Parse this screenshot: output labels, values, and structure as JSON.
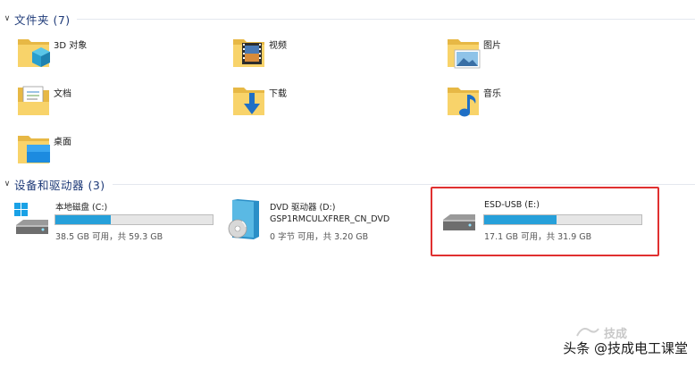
{
  "folders_section": {
    "title": "文件夹 (7)",
    "items": [
      {
        "label": "3D 对象",
        "icon": "3d-objects-folder-icon"
      },
      {
        "label": "视频",
        "icon": "videos-folder-icon"
      },
      {
        "label": "图片",
        "icon": "pictures-folder-icon"
      },
      {
        "label": "文档",
        "icon": "documents-folder-icon"
      },
      {
        "label": "下载",
        "icon": "downloads-folder-icon"
      },
      {
        "label": "音乐",
        "icon": "music-folder-icon"
      },
      {
        "label": "桌面",
        "icon": "desktop-folder-icon"
      }
    ]
  },
  "devices_section": {
    "title": "设备和驱动器 (3)",
    "drives": [
      {
        "name": "本地磁盘 (C:)",
        "size_text": "38.5 GB 可用，共 59.3 GB",
        "used_fraction": 0.35,
        "icon": "local-disk-icon"
      },
      {
        "name": "DVD 驱动器 (D:)",
        "subname": "GSP1RMCULXFRER_CN_DVD",
        "size_text": "0 字节 可用，共 3.20 GB",
        "icon": "dvd-drive-icon"
      },
      {
        "name": "ESD-USB (E:)",
        "size_text": "17.1 GB 可用，共 31.9 GB",
        "used_fraction": 0.46,
        "icon": "usb-drive-icon"
      }
    ]
  },
  "watermark": {
    "text": "头条 @技成电工课堂",
    "faint_text": "技成"
  },
  "colors": {
    "bar_fill": "#26a0da",
    "highlight_border": "#e03030",
    "section_title": "#1e3a78"
  }
}
